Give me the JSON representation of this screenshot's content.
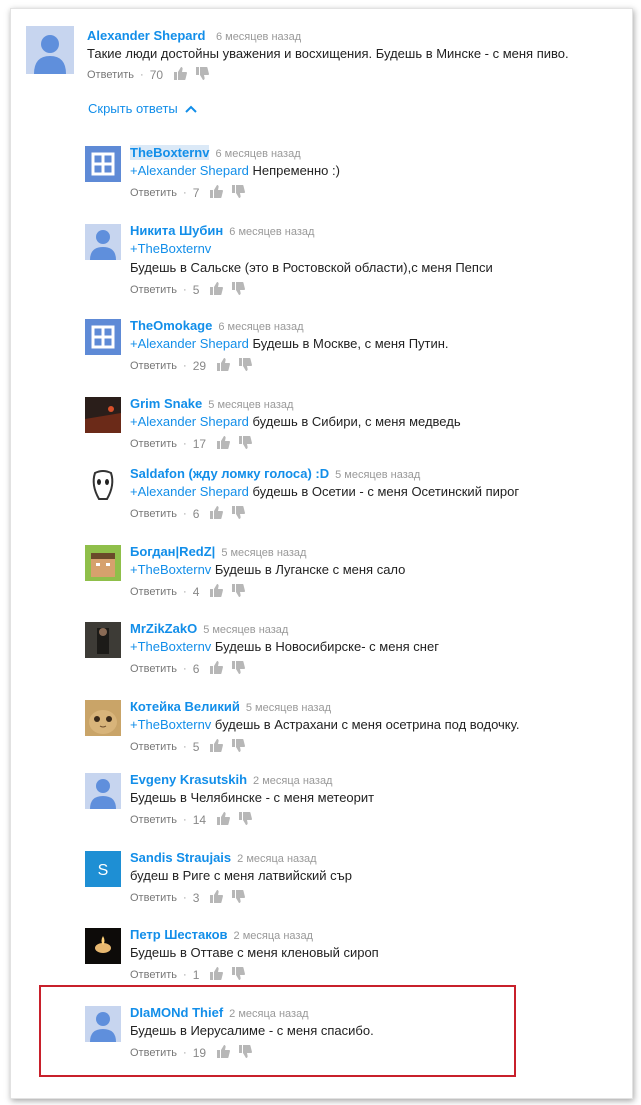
{
  "top_comment": {
    "author": "Alexander Shepard",
    "time": "6 месяцев назад",
    "text": "Такие люди достойны уважения и восхищения. Будешь в Минске - с меня пиво.",
    "reply_label": "Ответить",
    "separator": "·",
    "likes": "70"
  },
  "hide_replies_label": "Скрыть ответы",
  "replies": [
    {
      "author": "TheBoxternv",
      "time": "6 месяцев назад",
      "mention": "+Alexander Shepard",
      "text": " Непременно :)",
      "reply_label": "Ответить",
      "separator": "·",
      "likes": "7"
    },
    {
      "author": "Никита Шубин",
      "time": "6 месяцев назад",
      "mention": "+TheBoxternv",
      "text": "Будешь в Сальске (это в Ростовской области),с меня Пепси",
      "reply_label": "Ответить",
      "separator": "·",
      "likes": "5"
    },
    {
      "author": "TheOmokage",
      "time": "6 месяцев назад",
      "mention": "+Alexander Shepard",
      "text": " Будешь в Москве, с меня Путин.",
      "reply_label": "Ответить",
      "separator": "·",
      "likes": "29"
    },
    {
      "author": "Grim Snake",
      "time": "5 месяцев назад",
      "mention": "+Alexander Shepard",
      "text": " будешь в Сибири, с меня медведь",
      "reply_label": "Ответить",
      "separator": "·",
      "likes": "17"
    },
    {
      "author": "Saldafon (жду ломку голоса) :D",
      "time": "5 месяцев назад",
      "mention": "+Alexander Shepard",
      "text": " будешь в Осетии - с меня Осетинский пирог",
      "reply_label": "Ответить",
      "separator": "·",
      "likes": "6"
    },
    {
      "author": "Богдан|RedZ|",
      "time": "5 месяцев назад",
      "mention": "+TheBoxternv",
      "text": " Будешь в Луганске с меня сало",
      "reply_label": "Ответить",
      "separator": "·",
      "likes": "4"
    },
    {
      "author": "MrZikZakO",
      "time": "5 месяцев назад",
      "mention": "+TheBoxternv",
      "text": " Будешь в Новосибирске- с меня снег",
      "reply_label": "Ответить",
      "separator": "·",
      "likes": "6"
    },
    {
      "author": "Котейка Великий",
      "time": "5 месяцев назад",
      "mention": "+TheBoxternv",
      "text": "  будешь в Астрахани с меня осетрина под водочку.",
      "reply_label": "Ответить",
      "separator": "·",
      "likes": "5"
    },
    {
      "author": "Evgeny Krasutskih",
      "time": "2 месяца назад",
      "mention": "",
      "text": "Будешь в Челябинске - с меня метеорит",
      "reply_label": "Ответить",
      "separator": "·",
      "likes": "14"
    },
    {
      "author": "Sandis Straujais",
      "time": "2 месяца назад",
      "mention": "",
      "text": "будеш в Риге с меня латвийский сър",
      "reply_label": "Ответить",
      "separator": "·",
      "likes": "3"
    },
    {
      "author": "Петр Шестаков",
      "time": "2 месяца назад",
      "mention": "",
      "text": "Будешь в Оттаве с меня кленовый сироп",
      "reply_label": "Ответить",
      "separator": "·",
      "likes": "1"
    },
    {
      "author": "DIaMONd Thief",
      "time": "2 месяца назад",
      "mention": "",
      "text": "Будешь в Иерусалиме - с меня спасибо.",
      "reply_label": "Ответить",
      "separator": "·",
      "likes": "19"
    }
  ],
  "avatar_letters": {
    "sandis": "S"
  },
  "colors": {
    "link": "#128ee9",
    "highlight_box": "#c8202b",
    "default_avatar": "#8aa8de"
  }
}
